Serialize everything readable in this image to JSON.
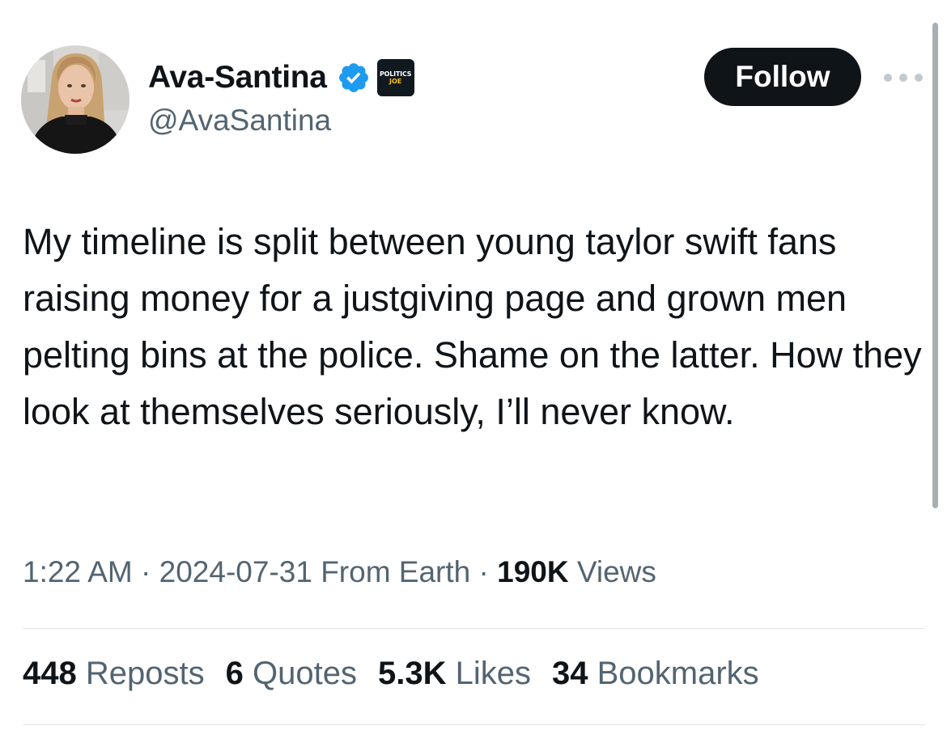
{
  "author": {
    "display_name": "Ava-Santina",
    "handle": "@AvaSantina",
    "verified": true,
    "verified_color": "#1D9BF0",
    "affiliate_badge": {
      "line1": "POLITICS",
      "line2": "JOE"
    }
  },
  "actions": {
    "follow_label": "Follow",
    "more_icon": "more-horizontal-icon"
  },
  "tweet": {
    "text": "My timeline is split between young taylor swift fans raising money for a justgiving page and grown men pelting bins at the police. Shame on the latter. How they look at themselves seriously, I’ll never know.",
    "time": "1:22 AM",
    "date": "2024-07-31",
    "source": "From Earth",
    "separator": "·",
    "views_count": "190K",
    "views_label": "Views"
  },
  "stats": [
    {
      "count": "448",
      "label": "Reposts"
    },
    {
      "count": "6",
      "label": "Quotes"
    },
    {
      "count": "5.3K",
      "label": "Likes"
    },
    {
      "count": "34",
      "label": "Bookmarks"
    }
  ],
  "colors": {
    "text_primary": "#0F1419",
    "text_secondary": "#536471",
    "follow_bg": "#0F1419",
    "divider": "#E1E6EA"
  }
}
